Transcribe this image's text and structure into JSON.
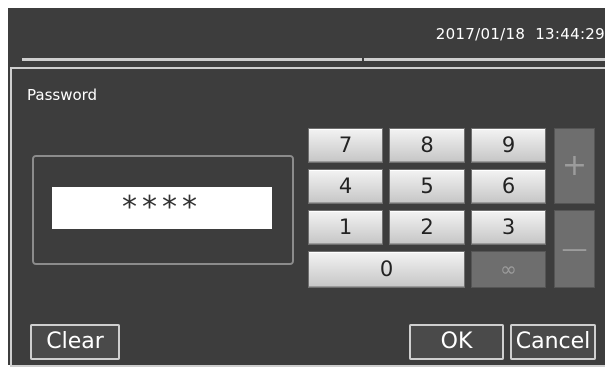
{
  "status_bar": {
    "date": "2017/01/18",
    "time": "13:44:29"
  },
  "dialog": {
    "title": "Password",
    "password_display": "****"
  },
  "keypad": {
    "digits": [
      "7",
      "8",
      "9",
      "4",
      "5",
      "6",
      "1",
      "2",
      "3"
    ],
    "zero": "0",
    "infinity": "∞",
    "plus": "+",
    "minus": "—"
  },
  "buttons": {
    "clear": "Clear",
    "ok": "OK",
    "cancel": "Cancel"
  },
  "colors": {
    "background": "#3d3d3d",
    "key_face": "#e0e0e0",
    "key_disabled": "#6e6e6e",
    "border": "#cfcfcf"
  }
}
